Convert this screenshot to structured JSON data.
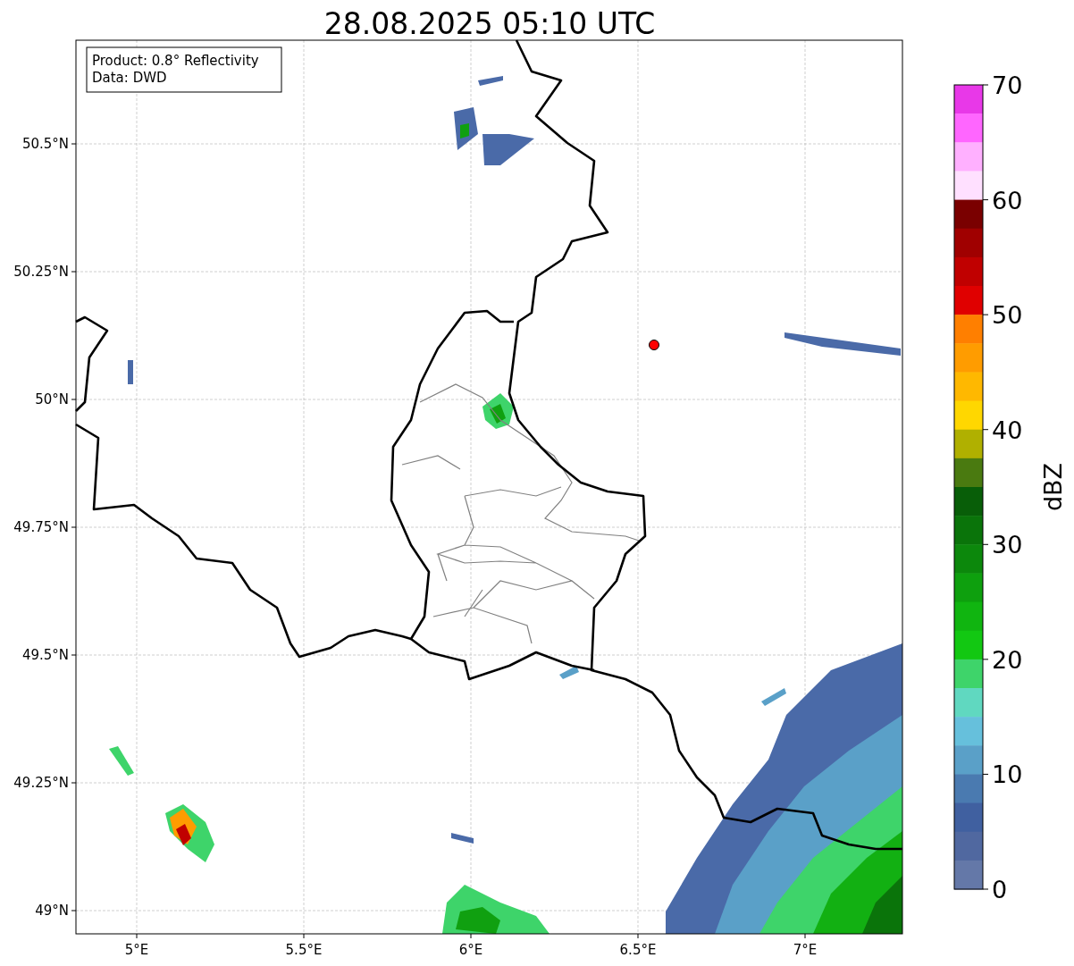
{
  "title": "28.08.2025 05:10 UTC",
  "legend": [
    "Product: 0.8° Reflectivity",
    "Data: DWD"
  ],
  "map": {
    "x_ticks": [
      "5°E",
      "5.5°E",
      "6°E",
      "6.5°E",
      "7°E"
    ],
    "y_ticks": [
      "50.5°N",
      "50.25°N",
      "50°N",
      "49.75°N",
      "49.5°N",
      "49.25°N",
      "49°N"
    ]
  },
  "colorbar": {
    "label": "dBZ",
    "ticks": [
      "70",
      "60",
      "50",
      "40",
      "30",
      "20",
      "10",
      "0"
    ],
    "segments": [
      {
        "color": "#e838e8"
      },
      {
        "color": "#ff66ff"
      },
      {
        "color": "#ffb0ff"
      },
      {
        "color": "#ffe0ff"
      },
      {
        "color": "#7a0000"
      },
      {
        "color": "#a00000"
      },
      {
        "color": "#c00000"
      },
      {
        "color": "#e00000"
      },
      {
        "color": "#ff7f00"
      },
      {
        "color": "#ff9c00"
      },
      {
        "color": "#ffb800"
      },
      {
        "color": "#ffd700"
      },
      {
        "color": "#b0b000"
      },
      {
        "color": "#4a7a10"
      },
      {
        "color": "#085e08"
      },
      {
        "color": "#0a740a"
      },
      {
        "color": "#0c880c"
      },
      {
        "color": "#0ea00e"
      },
      {
        "color": "#10b510"
      },
      {
        "color": "#12c812"
      },
      {
        "color": "#3ed46a"
      },
      {
        "color": "#60d8c0"
      },
      {
        "color": "#66c0dc"
      },
      {
        "color": "#5aa0c8"
      },
      {
        "color": "#4a7ab0"
      },
      {
        "color": "#4060a0"
      },
      {
        "color": "#5068a0"
      },
      {
        "color": "#6478a8"
      }
    ]
  }
}
